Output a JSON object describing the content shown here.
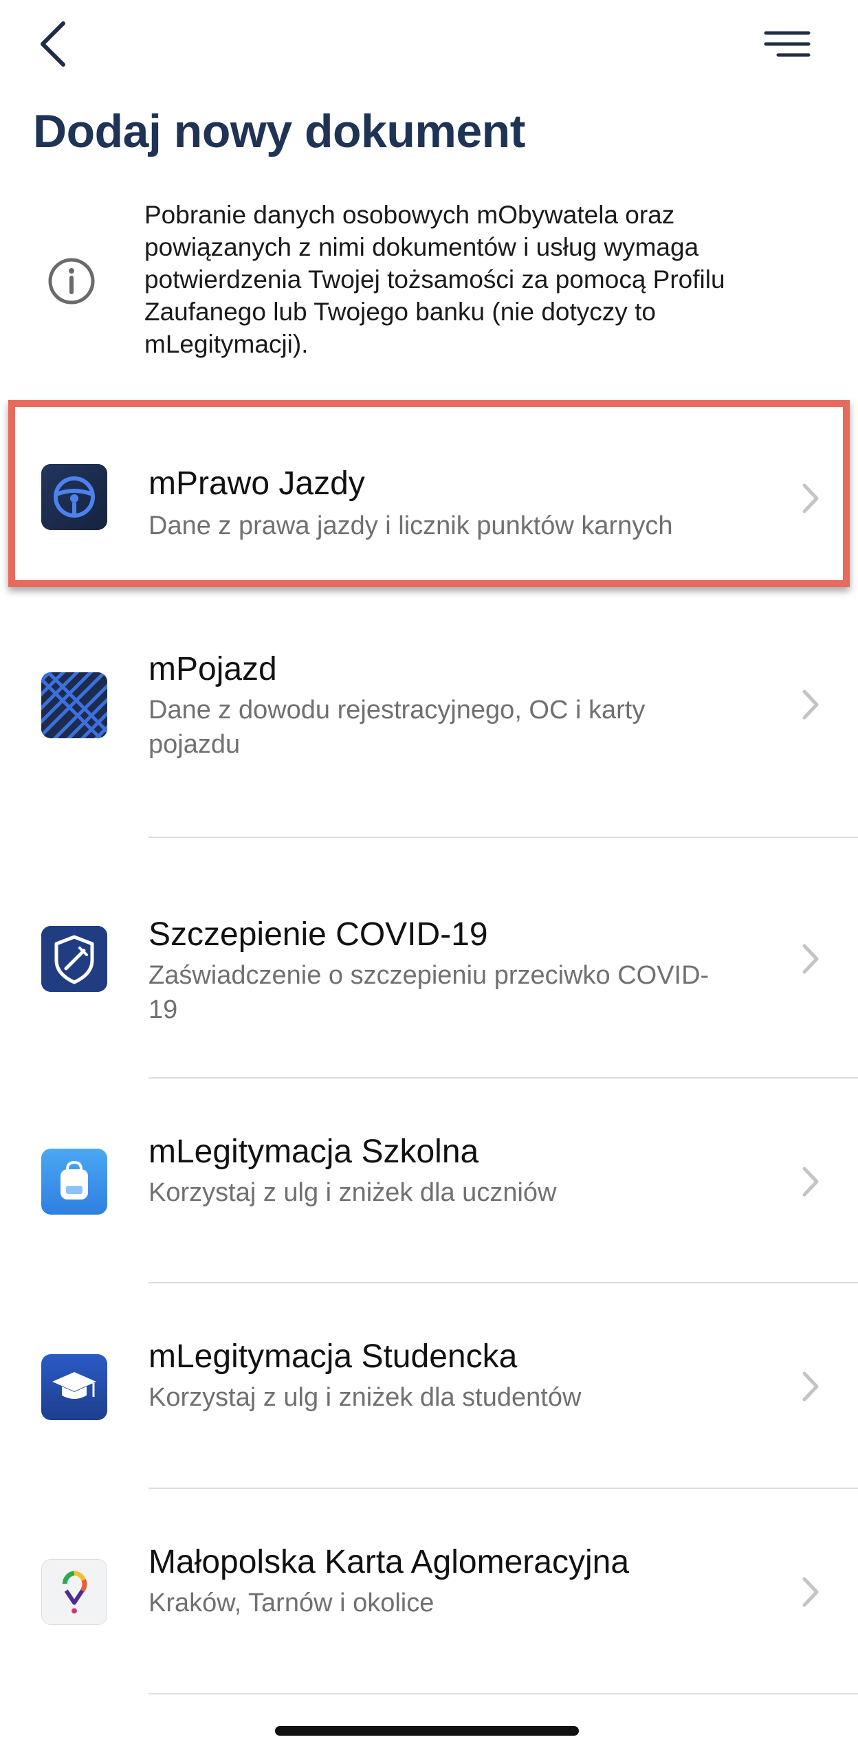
{
  "header": {
    "back_icon": "chevron-left-icon",
    "menu_icon": "hamburger-menu-icon",
    "title": "Dodaj nowy dokument"
  },
  "info": {
    "icon": "info-circle-icon",
    "text": "Pobranie danych osobowych mObywatela oraz powiązanych z nimi dokumentów i usług wymaga potwierdzenia Twojej tożsamości za pomocą Profilu Zaufanego lub Twojego banku (nie dotyczy to mLegitymacji)."
  },
  "items": [
    {
      "title": "mPrawo Jazdy",
      "subtitle": "Dane z prawa jazdy i licznik punktów karnych",
      "icon": "steering-wheel-icon"
    },
    {
      "title": "mPojazd",
      "subtitle": "Dane z dowodu rejestracyjnego, OC i karty pojazdu",
      "icon": "tire-tread-icon"
    },
    {
      "title": "Szczepienie COVID-19",
      "subtitle": "Zaświadczenie o szczepieniu przeciwko COVID-19",
      "icon": "shield-syringe-icon"
    },
    {
      "title": "mLegitymacja Szkolna",
      "subtitle": "Korzystaj z ulg i zniżek dla uczniów",
      "icon": "backpack-icon"
    },
    {
      "title": "mLegitymacja Studencka",
      "subtitle": "Korzystaj z ulg i zniżek dla studentów",
      "icon": "graduation-cap-icon"
    },
    {
      "title": "Małopolska Karta Aglomeracyjna",
      "subtitle": "Kraków, Tarnów i okolice",
      "icon": "location-pin-icon"
    }
  ],
  "colors": {
    "title": "#1f3355",
    "highlight": "#e86a5c",
    "icon_dark": "#1c2c4c",
    "icon_blue": "#3a6fd8"
  }
}
